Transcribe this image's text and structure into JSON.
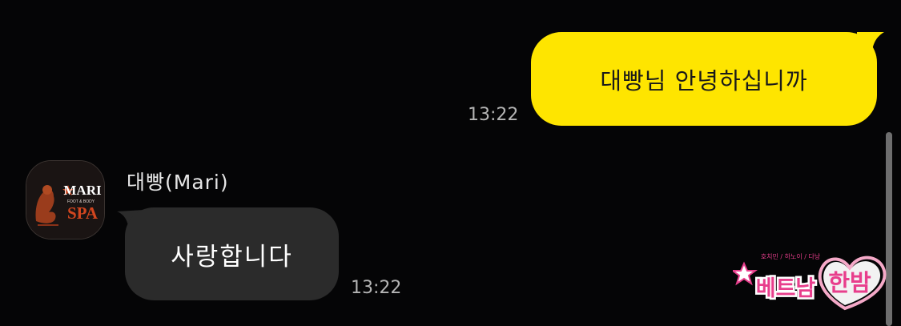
{
  "messages": {
    "outgoing": {
      "text": "대빵님 안녕하십니까",
      "time": "13:22"
    },
    "incoming": {
      "sender": "대빵(Mari)",
      "text": "사랑합니다",
      "time": "13:22"
    }
  },
  "avatar": {
    "brand_line1": "MARI",
    "brand_small": "FOOT & BODY",
    "brand_line2": "SPA"
  },
  "watermark": {
    "small_text": "호치민 / 하노이 / 다낭",
    "text_a": "베트남",
    "text_b": "한밤"
  },
  "colors": {
    "background": "#050506",
    "outgoing_bubble": "#fee500",
    "incoming_bubble": "#2b2b2b",
    "timestamp": "#b4b4b4",
    "watermark_pink": "#e83e8c"
  },
  "icons": {
    "star": "star-icon",
    "heart": "heart-icon"
  }
}
